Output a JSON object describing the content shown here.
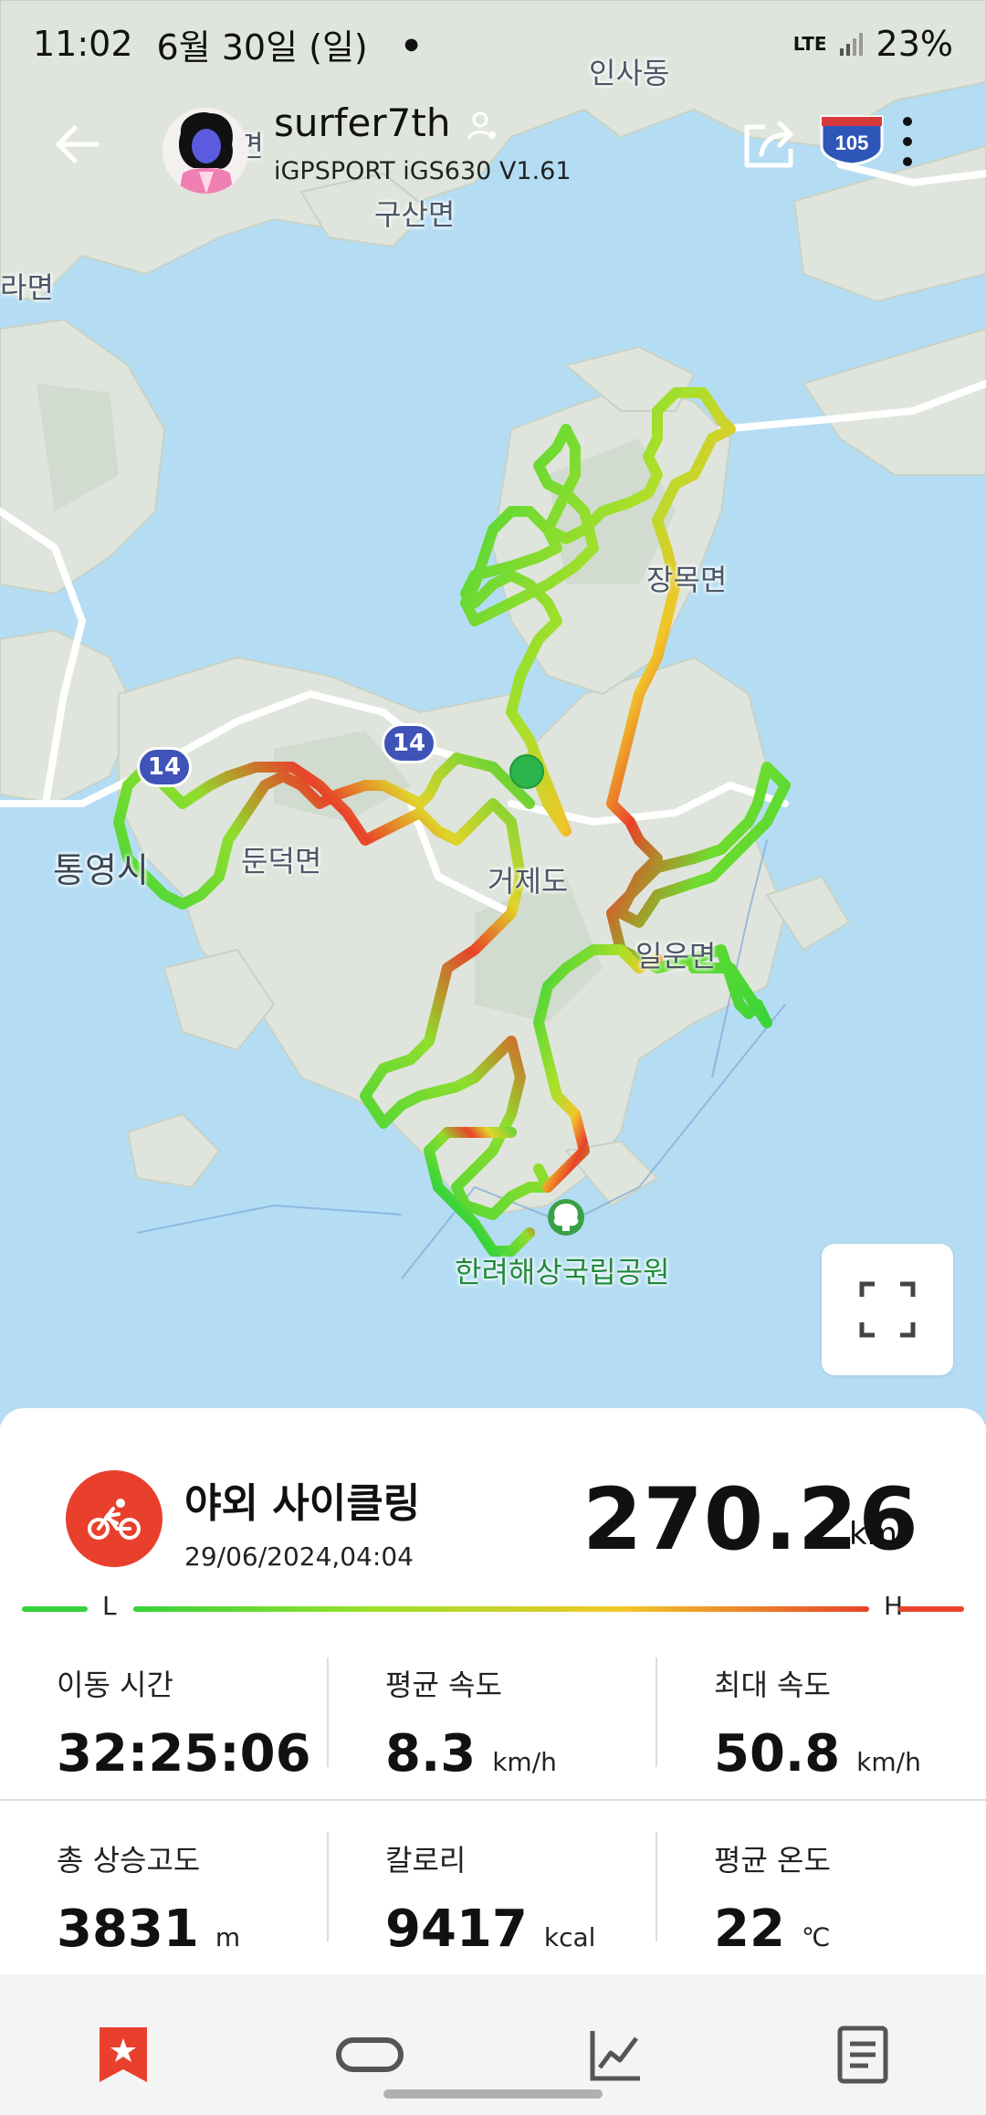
{
  "status_bar": {
    "time": "11:02",
    "date": "6월 30일 (일)",
    "network": "LTE",
    "battery": "23%"
  },
  "header": {
    "username": "surfer7th",
    "device": "iGPSPORT iGS630  V1.61"
  },
  "map": {
    "labels": {
      "insadong": "인사동",
      "dongmyeon": "동면",
      "gusanmyeon": "구산면",
      "ramyeon": "라면",
      "tongyeong": "통영시",
      "dundeok": "둔덕면",
      "geoje": "거제도",
      "jangmok": "장목면",
      "ilun": "일운면",
      "park": "한려해상국립공원"
    },
    "shields": {
      "route_14_a": "14",
      "route_14_b": "14",
      "route_105": "105"
    }
  },
  "activity": {
    "name": "야외 사이클링",
    "datetime": "29/06/2024,04:04",
    "distance": "270.26",
    "distance_unit": "km"
  },
  "legend": {
    "low": "L",
    "high": "H"
  },
  "stats": {
    "moving_time": {
      "label": "이동 시간",
      "value": "32:25:06",
      "unit": ""
    },
    "avg_speed": {
      "label": "평균 속도",
      "value": "8.3",
      "unit": "km/h"
    },
    "max_speed": {
      "label": "최대 속도",
      "value": "50.8",
      "unit": "km/h"
    },
    "total_ascent": {
      "label": "총 상승고도",
      "value": "3831",
      "unit": "m"
    },
    "calories": {
      "label": "칼로리",
      "value": "9417",
      "unit": "kcal"
    },
    "avg_temp": {
      "label": "평균 온도",
      "value": "22",
      "unit": "℃"
    }
  },
  "colors": {
    "accent": "#e9402e",
    "route_low": "#35d33a",
    "route_high": "#e8432a"
  },
  "icons": {
    "back": "arrow-left-icon",
    "share": "share-icon",
    "more": "more-vertical-icon",
    "fullscreen": "fullscreen-icon",
    "activity": "bicycle-icon",
    "nav": [
      "bookmark-icon",
      "lap-icon",
      "chart-icon",
      "document-icon"
    ]
  }
}
